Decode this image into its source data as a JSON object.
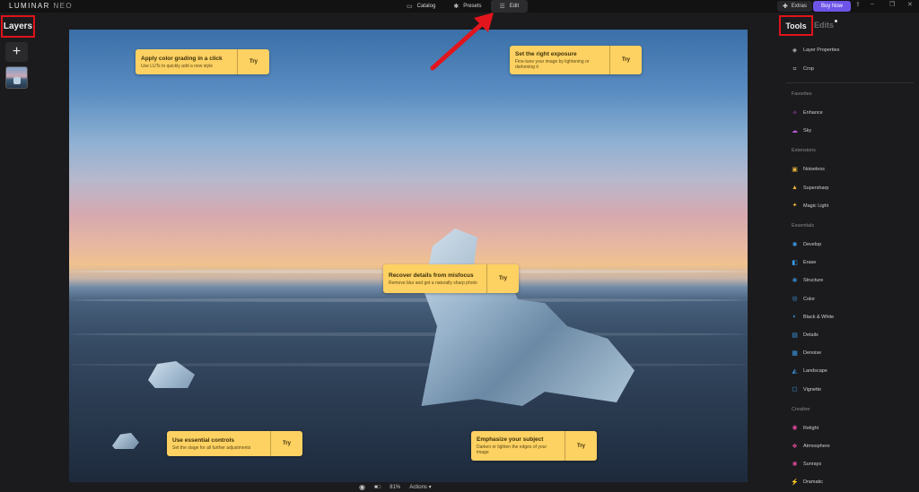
{
  "app": {
    "logo_main": "LUMINAR",
    "logo_sub": "NEO"
  },
  "topnav": [
    {
      "icon": "folder-icon",
      "glyph": "▭",
      "label": "Catalog"
    },
    {
      "icon": "presets-icon",
      "glyph": "✱",
      "label": "Presets"
    },
    {
      "icon": "edit-icon",
      "glyph": "☰",
      "label": "Edit"
    }
  ],
  "header_right": {
    "extras_label": "Extras",
    "buy_label": "Buy Now"
  },
  "left": {
    "layers_title": "Layers",
    "add_glyph": "+"
  },
  "tips": [
    {
      "title": "Apply color grading in a click",
      "desc": "Use LUTs to quickly add a new style",
      "try": "Try"
    },
    {
      "title": "Set the right exposure",
      "desc": "Fine-tune your image by lightening or darkening it",
      "try": "Try"
    },
    {
      "title": "Recover details from misfocus",
      "desc": "Remove blur and get a naturally sharp photo",
      "try": "Try"
    },
    {
      "title": "Use essential controls",
      "desc": "Set the stage for all further adjustments",
      "try": "Try"
    },
    {
      "title": "Emphasize your subject",
      "desc": "Darken or lighten the edges of your image",
      "try": "Try"
    }
  ],
  "bottom": {
    "zoom": "81%",
    "actions": "Actions"
  },
  "right": {
    "tools_title": "Tools",
    "edits_title": "Edits",
    "top_tools": [
      {
        "label": "Layer Properties",
        "icon": "layers-icon",
        "glyph": "◈"
      },
      {
        "label": "Crop",
        "icon": "crop-icon",
        "glyph": "⌗"
      }
    ],
    "sections": [
      {
        "header": "Favorites",
        "items": [
          {
            "label": "Enhance",
            "icon": "enhance-icon",
            "glyph": "✧",
            "color": "#c04ed6"
          },
          {
            "label": "Sky",
            "icon": "sky-icon",
            "glyph": "☁",
            "color": "#b65bd8"
          }
        ]
      },
      {
        "header": "Extensions",
        "items": [
          {
            "label": "Noiseless",
            "icon": "noiseless-icon",
            "glyph": "▣",
            "color": "#e8b23a"
          },
          {
            "label": "Supersharp",
            "icon": "supersharp-icon",
            "glyph": "▲",
            "color": "#e8b23a"
          },
          {
            "label": "Magic Light",
            "icon": "magic-light-icon",
            "glyph": "✦",
            "color": "#e8b23a"
          }
        ]
      },
      {
        "header": "Essentials",
        "items": [
          {
            "label": "Develop",
            "icon": "develop-icon",
            "glyph": "✺",
            "color": "#3a9be8"
          },
          {
            "label": "Erase",
            "icon": "erase-icon",
            "glyph": "◧",
            "color": "#3a9be8"
          },
          {
            "label": "Structure",
            "icon": "structure-icon",
            "glyph": "❋",
            "color": "#3a9be8"
          },
          {
            "label": "Color",
            "icon": "color-icon",
            "glyph": "◎",
            "color": "#3a9be8"
          },
          {
            "label": "Black & White",
            "icon": "black-white-icon",
            "glyph": "◐",
            "color": "#3a9be8"
          },
          {
            "label": "Details",
            "icon": "details-icon",
            "glyph": "▤",
            "color": "#3a9be8"
          },
          {
            "label": "Denoise",
            "icon": "denoise-icon",
            "glyph": "▦",
            "color": "#3a9be8"
          },
          {
            "label": "Landscape",
            "icon": "landscape-icon",
            "glyph": "◭",
            "color": "#3a9be8"
          },
          {
            "label": "Vignette",
            "icon": "vignette-icon",
            "glyph": "◻",
            "color": "#3a9be8"
          }
        ]
      },
      {
        "header": "Creative",
        "items": [
          {
            "label": "Relight",
            "icon": "relight-icon",
            "glyph": "◉",
            "color": "#e0489a"
          },
          {
            "label": "Atmosphere",
            "icon": "atmosphere-icon",
            "glyph": "❖",
            "color": "#e0489a"
          },
          {
            "label": "Sunrays",
            "icon": "sunrays-icon",
            "glyph": "✺",
            "color": "#e0489a"
          },
          {
            "label": "Dramatic",
            "icon": "dramatic-icon",
            "glyph": "⚡",
            "color": "#e0489a"
          }
        ]
      }
    ]
  }
}
